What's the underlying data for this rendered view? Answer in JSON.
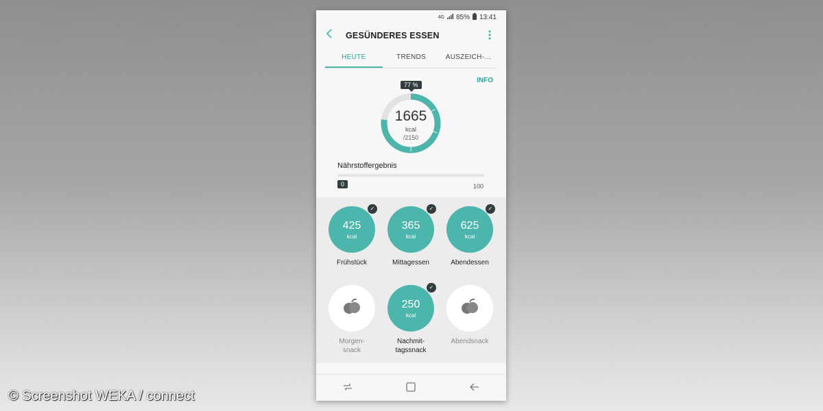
{
  "watermark": "© Screenshot WEKA / connect",
  "status": {
    "network": "4G",
    "battery": "85%",
    "time": "13:41"
  },
  "header": {
    "title": "GESÜNDERES ESSEN"
  },
  "tabs": [
    {
      "label": "HEUTE",
      "active": true
    },
    {
      "label": "TRENDS",
      "active": false
    },
    {
      "label": "AUSZEICH-…",
      "active": false
    }
  ],
  "summary": {
    "info_label": "INFO",
    "percent": "77 %",
    "kcal": "1665",
    "unit": "kcal",
    "goal": "/2150",
    "progress_fraction": 0.77
  },
  "nutrient": {
    "label": "Nährstoffergebnis",
    "value": "0",
    "max": "100",
    "fraction": 0
  },
  "meals": [
    {
      "label": "Frühstück",
      "kcal": "425",
      "unit": "kcal",
      "done": true
    },
    {
      "label": "Mittagessen",
      "kcal": "365",
      "unit": "kcal",
      "done": true
    },
    {
      "label": "Abendessen",
      "kcal": "625",
      "unit": "kcal",
      "done": true
    },
    {
      "label": "Morgen-\nsnack",
      "kcal": "",
      "unit": "",
      "done": false
    },
    {
      "label": "Nachmit-\ntagssnack",
      "kcal": "250",
      "unit": "kcal",
      "done": true
    },
    {
      "label": "Abendsnack",
      "kcal": "",
      "unit": "",
      "done": false
    }
  ],
  "colors": {
    "accent": "#4db6ac",
    "dark_badge": "#333d40"
  },
  "icons": {
    "recent": "recent-apps-icon",
    "home": "home-icon",
    "back": "back-icon",
    "snack": "fruit-icon"
  }
}
